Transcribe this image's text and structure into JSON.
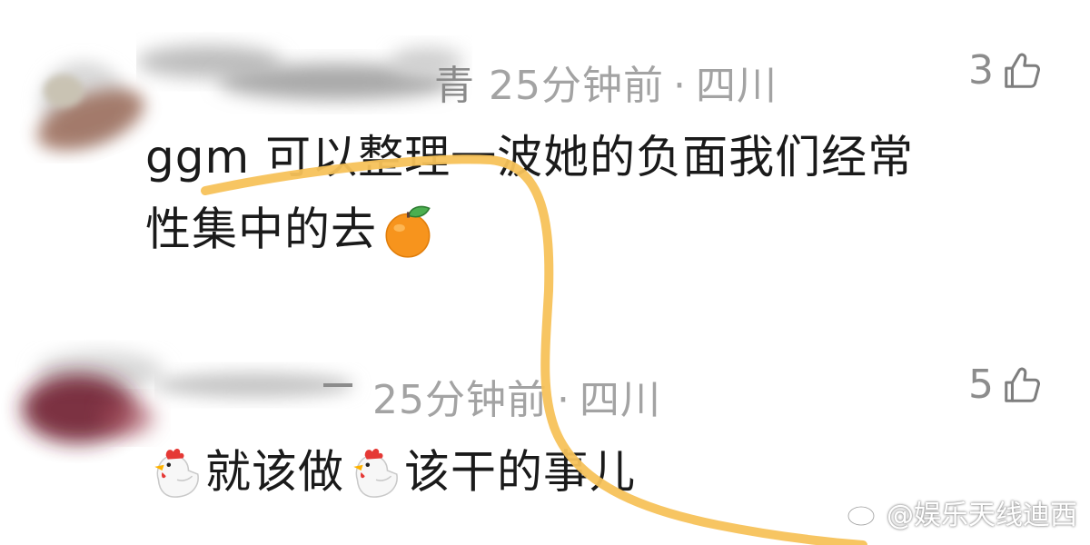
{
  "comments": [
    {
      "name_tail": "青",
      "time": "25分钟前",
      "separator": "·",
      "location": "四川",
      "likes": "3",
      "text_line1": "ggm 可以整理一波她的负面我们经常",
      "text_line2": "性集中的去",
      "emoji": "orange-icon"
    },
    {
      "name_tail": "",
      "time": "25分钟前",
      "separator": "·",
      "location": "四川",
      "likes": "5",
      "text_parts": [
        "就该做",
        "该干的事儿"
      ],
      "emoji": "chicken-icon"
    }
  ],
  "watermark": "@娱乐天线迪西",
  "colors": {
    "highlight_stroke": "#f7c25a",
    "meta_text": "#a3a3a3",
    "body_text": "#1a1a1a"
  }
}
